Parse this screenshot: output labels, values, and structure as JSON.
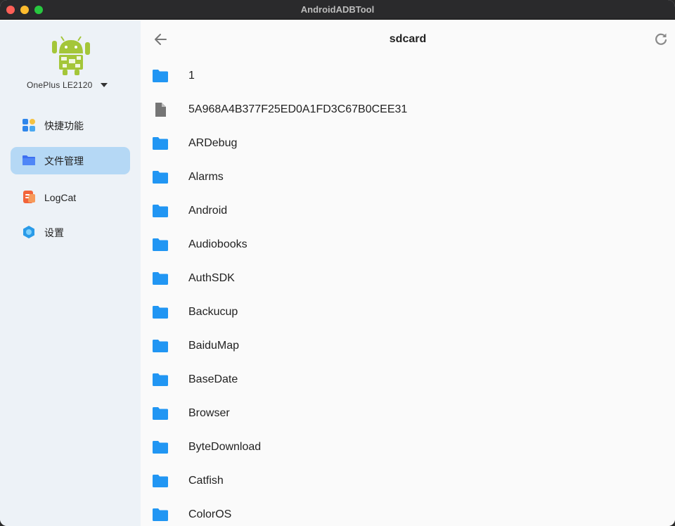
{
  "window": {
    "title": "AndroidADBTool"
  },
  "device": {
    "name": "OnePlus LE2120"
  },
  "nav": {
    "items": [
      {
        "label": "快捷功能",
        "icon": "quick-actions-icon",
        "active": false
      },
      {
        "label": "文件管理",
        "icon": "folder-icon",
        "active": true
      },
      {
        "label": "LogCat",
        "icon": "logcat-icon",
        "active": false
      },
      {
        "label": "设置",
        "icon": "settings-icon",
        "active": false
      }
    ]
  },
  "header": {
    "title": "sdcard"
  },
  "files": [
    {
      "name": "1",
      "type": "folder"
    },
    {
      "name": "5A968A4B377F25ED0A1FD3C67B0CEE31",
      "type": "file"
    },
    {
      "name": "ARDebug",
      "type": "folder"
    },
    {
      "name": "Alarms",
      "type": "folder"
    },
    {
      "name": "Android",
      "type": "folder"
    },
    {
      "name": "Audiobooks",
      "type": "folder"
    },
    {
      "name": "AuthSDK",
      "type": "folder"
    },
    {
      "name": "Backucup",
      "type": "folder"
    },
    {
      "name": "BaiduMap",
      "type": "folder"
    },
    {
      "name": "BaseDate",
      "type": "folder"
    },
    {
      "name": "Browser",
      "type": "folder"
    },
    {
      "name": "ByteDownload",
      "type": "folder"
    },
    {
      "name": "Catfish",
      "type": "folder"
    },
    {
      "name": "ColorOS",
      "type": "folder"
    }
  ],
  "colors": {
    "folder": "#2196f3",
    "file": "#757575",
    "active_nav": "#b5d8f5",
    "sidebar_bg": "#edf2f7",
    "android_green": "#a4c639"
  }
}
